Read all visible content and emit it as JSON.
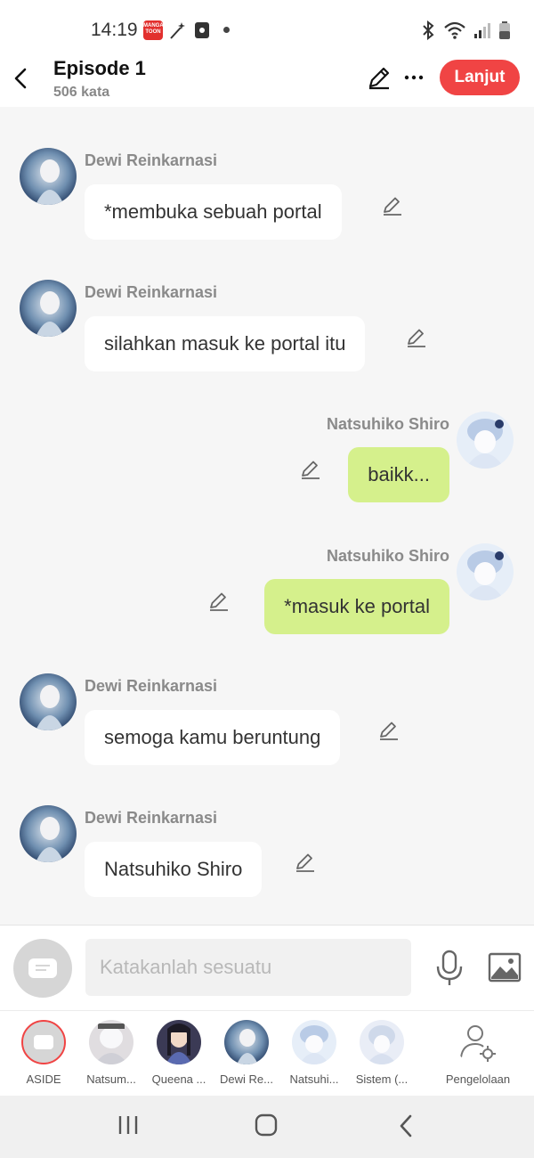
{
  "status_bar": {
    "time": "14:19",
    "app_badge": "MANGA TOON"
  },
  "header": {
    "title": "Episode 1",
    "word_count": "506 kata",
    "next_label": "Lanjut"
  },
  "messages": [
    {
      "speaker": "Dewi Reinkarnasi",
      "text": "*membuka sebuah portal",
      "side": "left"
    },
    {
      "speaker": "Dewi Reinkarnasi",
      "text": "silahkan masuk ke portal itu",
      "side": "left"
    },
    {
      "speaker": "Natsuhiko Shiro",
      "text": "baikk...",
      "side": "right"
    },
    {
      "speaker": "Natsuhiko Shiro",
      "text": "*masuk ke portal",
      "side": "right"
    },
    {
      "speaker": "Dewi Reinkarnasi",
      "text": "semoga kamu beruntung",
      "side": "left"
    },
    {
      "speaker": "Dewi Reinkarnasi",
      "text": "Natsuhiko Shiro",
      "side": "left"
    }
  ],
  "composer": {
    "placeholder": "Katakanlah sesuatu"
  },
  "characters": [
    {
      "label": "ASIDE"
    },
    {
      "label": "Natsum..."
    },
    {
      "label": "Queena ..."
    },
    {
      "label": "Dewi Re..."
    },
    {
      "label": "Natsuhi..."
    },
    {
      "label": "Sistem (..."
    },
    {
      "label": "Pengelolaan"
    }
  ],
  "colors": {
    "accent": "#f04444",
    "bubble_right": "#d5f08c",
    "bubble_left": "#ffffff",
    "background": "#f6f6f6"
  }
}
